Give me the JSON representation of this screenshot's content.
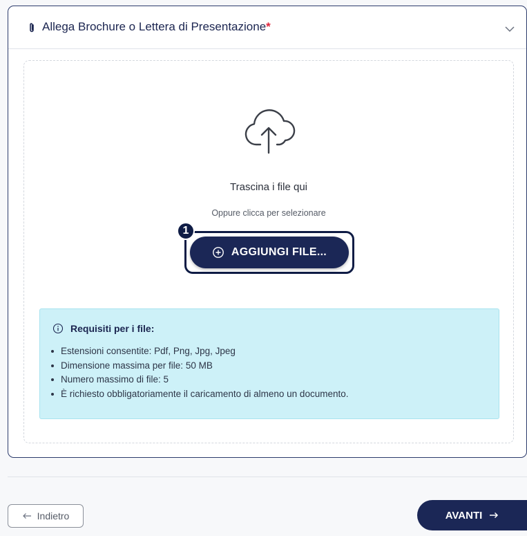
{
  "section": {
    "title": "Allega Brochure o Lettera di Presentazione",
    "required_marker": "*",
    "icon": "paperclip-icon",
    "collapse_icon": "chevron-down-icon"
  },
  "dropzone": {
    "icon": "cloud-upload-icon",
    "title": "Trascina i file qui",
    "subtitle": "Oppure clicca per selezionare",
    "add_button_label": "AGGIUNGI FILE...",
    "add_button_icon": "plus-circle-icon",
    "step_badge": "1"
  },
  "requirements": {
    "icon": "info-icon",
    "title": "Requisiti per i file:",
    "items": [
      "Estensioni consentite: Pdf, Png, Jpg, Jpeg",
      "Dimensione massima per file: 50 MB",
      "Numero massimo di file: 5",
      "È richiesto obbligatoriamente il caricamento di almeno un documento."
    ]
  },
  "footer": {
    "back_label": "Indietro",
    "back_icon": "arrow-left-icon",
    "next_label": "AVANTI",
    "next_icon": "arrow-right-icon"
  },
  "colors": {
    "primary": "#1b2756",
    "required": "#e0243b",
    "info_bg": "#cdf1f8"
  }
}
